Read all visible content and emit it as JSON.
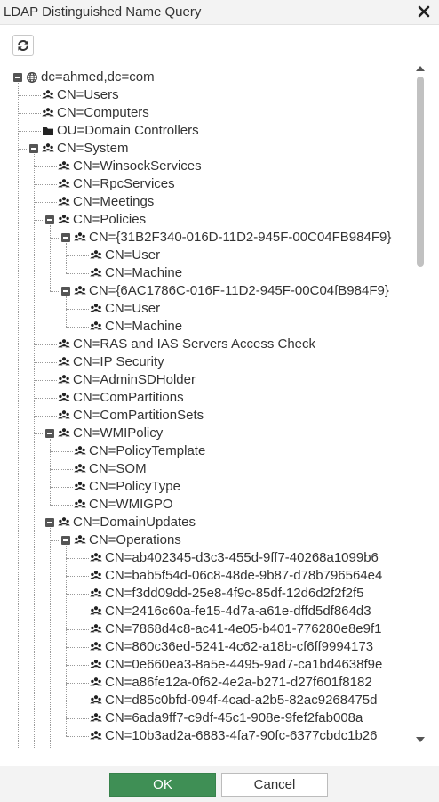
{
  "dialog": {
    "title": "LDAP Distinguished Name Query",
    "close_icon": "close-icon",
    "refresh_icon": "refresh-icon"
  },
  "tree": {
    "root": "dc=ahmed,dc=com",
    "nodes": [
      {
        "label": "CN=Users",
        "depth": 1,
        "icon": "group-icon",
        "expanded": false
      },
      {
        "label": "CN=Computers",
        "depth": 1,
        "icon": "group-icon",
        "expanded": false
      },
      {
        "label": "OU=Domain Controllers",
        "depth": 1,
        "icon": "folder-icon",
        "expanded": false
      },
      {
        "label": "CN=System",
        "depth": 1,
        "icon": "group-icon",
        "expanded": true
      },
      {
        "label": "CN=WinsockServices",
        "depth": 2,
        "icon": "group-icon",
        "expanded": false
      },
      {
        "label": "CN=RpcServices",
        "depth": 2,
        "icon": "group-icon",
        "expanded": false
      },
      {
        "label": "CN=Meetings",
        "depth": 2,
        "icon": "group-icon",
        "expanded": false
      },
      {
        "label": "CN=Policies",
        "depth": 2,
        "icon": "group-icon",
        "expanded": true
      },
      {
        "label": "CN={31B2F340-016D-11D2-945F-00C04FB984F9}",
        "depth": 3,
        "icon": "group-icon",
        "expanded": true
      },
      {
        "label": "CN=User",
        "depth": 4,
        "icon": "group-icon",
        "expanded": false
      },
      {
        "label": "CN=Machine",
        "depth": 4,
        "icon": "group-icon",
        "expanded": false
      },
      {
        "label": "CN={6AC1786C-016F-11D2-945F-00C04fB984F9}",
        "depth": 3,
        "icon": "group-icon",
        "expanded": true
      },
      {
        "label": "CN=User",
        "depth": 4,
        "icon": "group-icon",
        "expanded": false
      },
      {
        "label": "CN=Machine",
        "depth": 4,
        "icon": "group-icon",
        "expanded": false
      },
      {
        "label": "CN=RAS and IAS Servers Access Check",
        "depth": 2,
        "icon": "group-icon",
        "expanded": false
      },
      {
        "label": "CN=IP Security",
        "depth": 2,
        "icon": "group-icon",
        "expanded": false
      },
      {
        "label": "CN=AdminSDHolder",
        "depth": 2,
        "icon": "group-icon",
        "expanded": false
      },
      {
        "label": "CN=ComPartitions",
        "depth": 2,
        "icon": "group-icon",
        "expanded": false
      },
      {
        "label": "CN=ComPartitionSets",
        "depth": 2,
        "icon": "group-icon",
        "expanded": false
      },
      {
        "label": "CN=WMIPolicy",
        "depth": 2,
        "icon": "group-icon",
        "expanded": true
      },
      {
        "label": "CN=PolicyTemplate",
        "depth": 3,
        "icon": "group-icon",
        "expanded": false
      },
      {
        "label": "CN=SOM",
        "depth": 3,
        "icon": "group-icon",
        "expanded": false
      },
      {
        "label": "CN=PolicyType",
        "depth": 3,
        "icon": "group-icon",
        "expanded": false
      },
      {
        "label": "CN=WMIGPO",
        "depth": 3,
        "icon": "group-icon",
        "expanded": false
      },
      {
        "label": "CN=DomainUpdates",
        "depth": 2,
        "icon": "group-icon",
        "expanded": true
      },
      {
        "label": "CN=Operations",
        "depth": 3,
        "icon": "group-icon",
        "expanded": true
      },
      {
        "label": "CN=ab402345-d3c3-455d-9ff7-40268a1099b6",
        "depth": 4,
        "icon": "group-icon",
        "expanded": false
      },
      {
        "label": "CN=bab5f54d-06c8-48de-9b87-d78b796564e4",
        "depth": 4,
        "icon": "group-icon",
        "expanded": false
      },
      {
        "label": "CN=f3dd09dd-25e8-4f9c-85df-12d6d2f2f2f5",
        "depth": 4,
        "icon": "group-icon",
        "expanded": false
      },
      {
        "label": "CN=2416c60a-fe15-4d7a-a61e-dffd5df864d3",
        "depth": 4,
        "icon": "group-icon",
        "expanded": false
      },
      {
        "label": "CN=7868d4c8-ac41-4e05-b401-776280e8e9f1",
        "depth": 4,
        "icon": "group-icon",
        "expanded": false
      },
      {
        "label": "CN=860c36ed-5241-4c62-a18b-cf6ff9994173",
        "depth": 4,
        "icon": "group-icon",
        "expanded": false
      },
      {
        "label": "CN=0e660ea3-8a5e-4495-9ad7-ca1bd4638f9e",
        "depth": 4,
        "icon": "group-icon",
        "expanded": false
      },
      {
        "label": "CN=a86fe12a-0f62-4e2a-b271-d27f601f8182",
        "depth": 4,
        "icon": "group-icon",
        "expanded": false
      },
      {
        "label": "CN=d85c0bfd-094f-4cad-a2b5-82ac9268475d",
        "depth": 4,
        "icon": "group-icon",
        "expanded": false
      },
      {
        "label": "CN=6ada9ff7-c9df-45c1-908e-9fef2fab008a",
        "depth": 4,
        "icon": "group-icon",
        "expanded": false
      },
      {
        "label": "CN=10b3ad2a-6883-4fa7-90fc-6377cbdc1b26",
        "depth": 4,
        "icon": "group-icon",
        "expanded": false
      }
    ]
  },
  "footer": {
    "ok_label": "OK",
    "cancel_label": "Cancel"
  },
  "colors": {
    "ok_button": "#3f8f55",
    "titlebar": "#f3f3f3",
    "scroll_thumb": "#c1c1c1"
  }
}
